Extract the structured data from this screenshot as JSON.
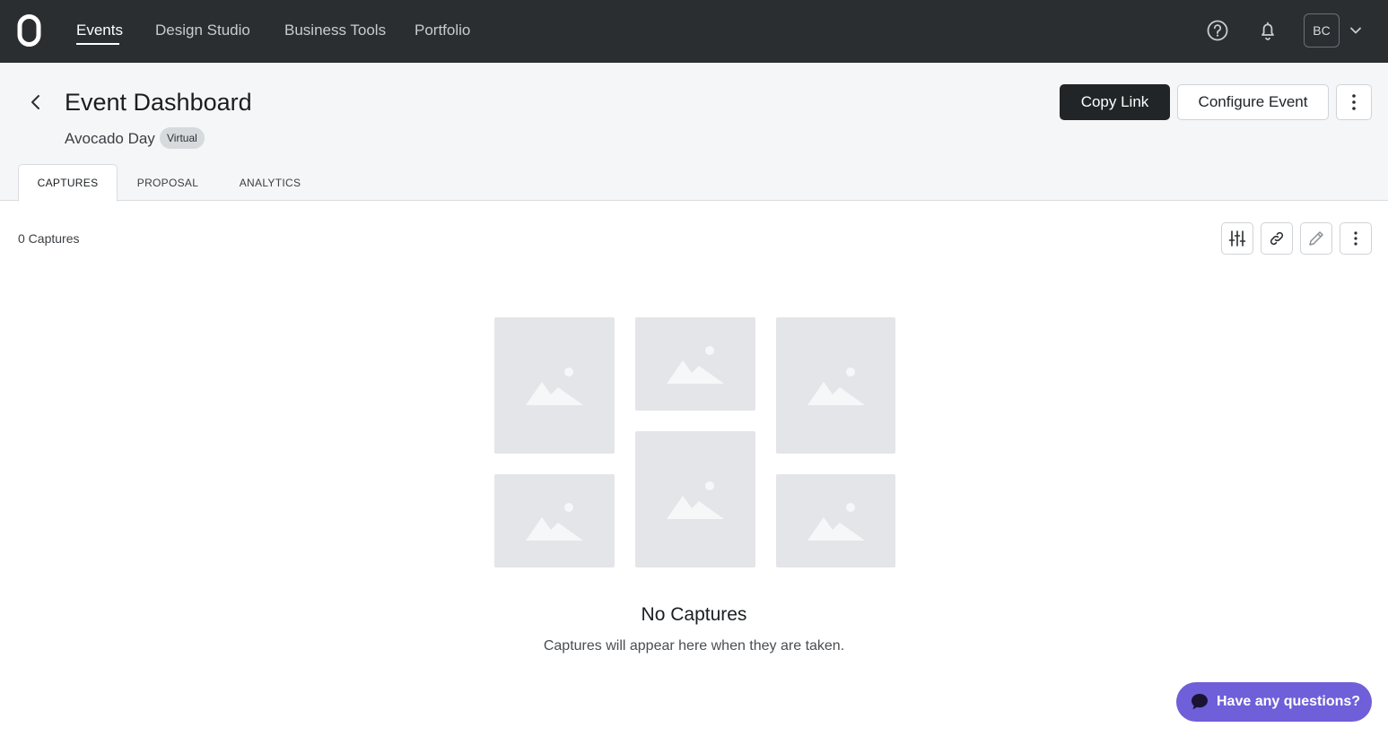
{
  "nav": {
    "links": [
      "Events",
      "Design Studio",
      "Business Tools",
      "Portfolio"
    ],
    "active": "Events",
    "avatar_initials": "BC"
  },
  "header": {
    "title": "Event Dashboard",
    "event_name": "Avocado Day",
    "badge": "Virtual",
    "copy_link_label": "Copy Link",
    "configure_label": "Configure Event"
  },
  "tabs": [
    "CAPTURES",
    "PROPOSAL",
    "ANALYTICS"
  ],
  "active_tab": "CAPTURES",
  "captures": {
    "count_label": "0 Captures",
    "empty_title": "No Captures",
    "empty_subtitle": "Captures will appear here when they are taken."
  },
  "chat": {
    "label": "Have any questions?"
  },
  "colors": {
    "nav_bg": "#2b2e31",
    "primary_button": "#222528",
    "chat_accent": "#6f5fd8",
    "placeholder_bg": "#e3e5e8"
  }
}
